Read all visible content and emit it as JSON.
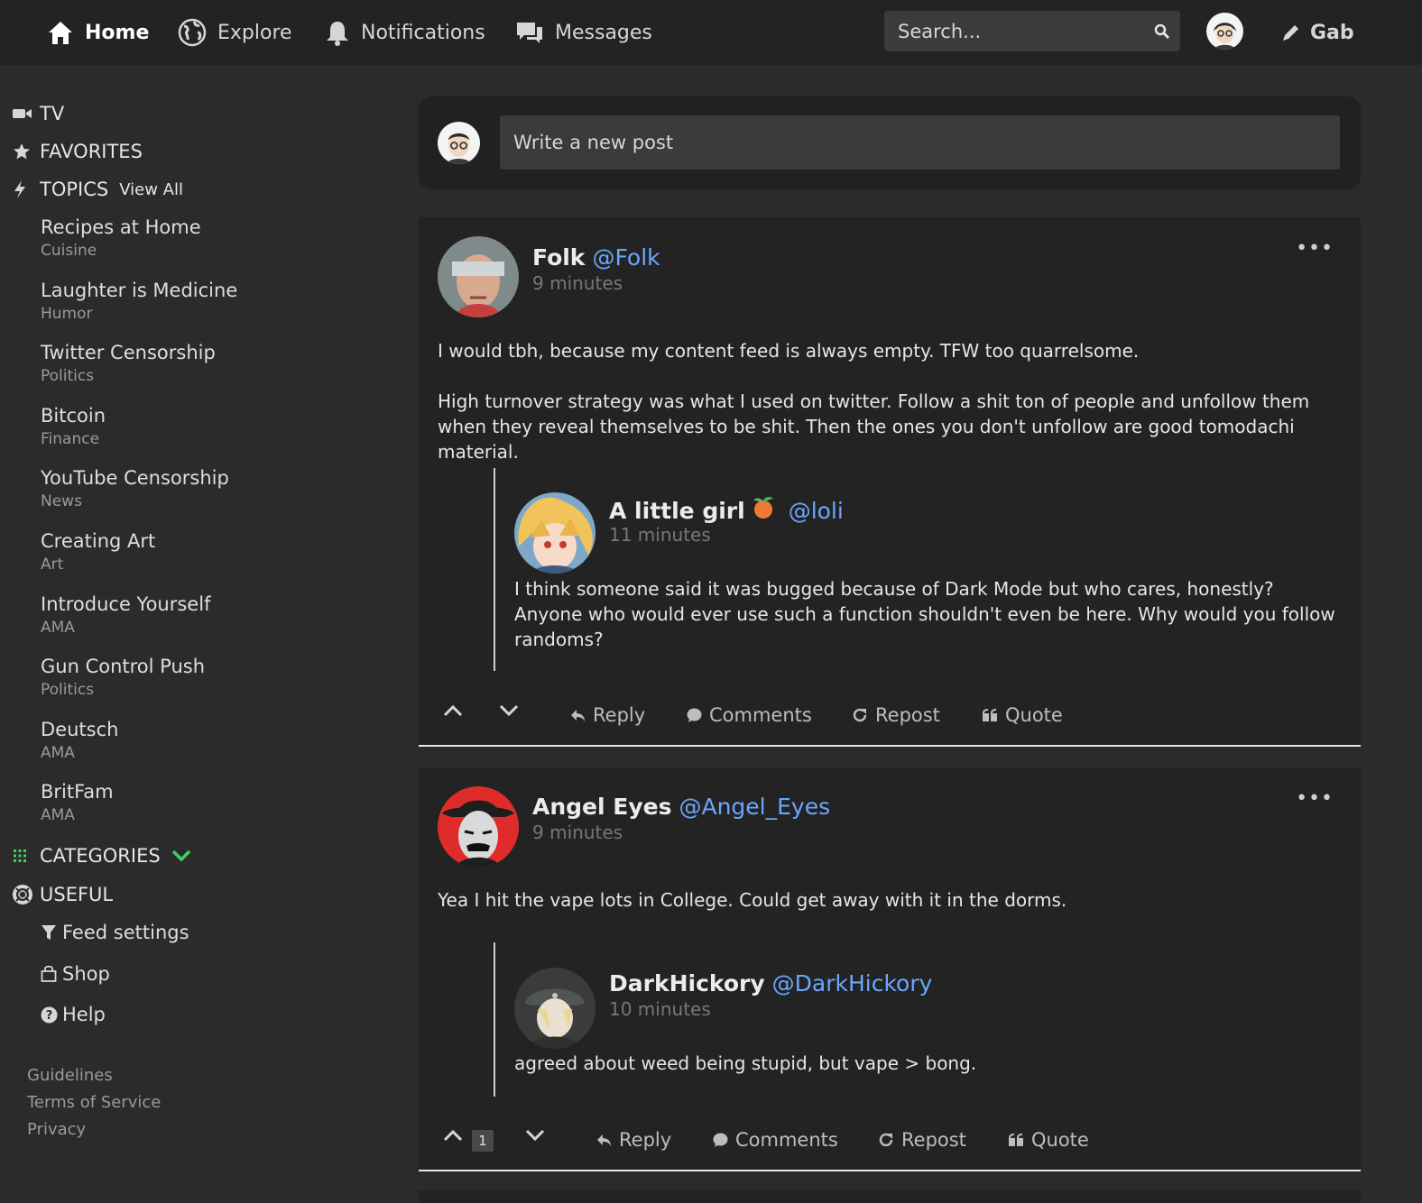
{
  "nav": {
    "home": "Home",
    "explore": "Explore",
    "notifications": "Notifications",
    "messages": "Messages",
    "search_placeholder": "Search...",
    "gab": "Gab"
  },
  "sidebar": {
    "tv": "TV",
    "favorites": "FAVORITES",
    "topics": "TOPICS",
    "view_all": "View All",
    "topic_items": [
      {
        "title": "Recipes at Home",
        "sub": "Cuisine"
      },
      {
        "title": "Laughter is Medicine",
        "sub": "Humor"
      },
      {
        "title": "Twitter Censorship",
        "sub": "Politics"
      },
      {
        "title": "Bitcoin",
        "sub": "Finance"
      },
      {
        "title": "YouTube Censorship",
        "sub": "News"
      },
      {
        "title": "Creating Art",
        "sub": "Art"
      },
      {
        "title": "Introduce Yourself",
        "sub": "AMA"
      },
      {
        "title": "Gun Control Push",
        "sub": "Politics"
      },
      {
        "title": "Deutsch",
        "sub": "AMA"
      },
      {
        "title": "BritFam",
        "sub": "AMA"
      }
    ],
    "categories": "CATEGORIES",
    "useful": "USEFUL",
    "useful_items": [
      "Feed settings",
      "Shop",
      "Help"
    ],
    "footer_links": [
      "Guidelines",
      "Terms of Service",
      "Privacy"
    ],
    "accent_green": "#3ecf6a"
  },
  "composer": {
    "placeholder": "Write a new post"
  },
  "posts": [
    {
      "name": "Folk",
      "handle": "@Folk",
      "time": "9 minutes",
      "body": [
        "I would tbh, because my content feed is always empty. TFW too quarrelsome.",
        "High turnover strategy was what I used on twitter. Follow a shit ton of people and unfollow them when they reveal themselves to be shit. Then the ones you don't unfollow are good tomodachi material."
      ],
      "quoted": {
        "name": "A little girl",
        "handle": "@loli",
        "time": "11 minutes",
        "body": "I think someone said it was bugged because of Dark Mode but who cares, honestly? Anyone who would ever use such a function shouldn't even be here. Why would you follow randoms?"
      },
      "vote_count": "",
      "actions": {
        "reply": "Reply",
        "comments": "Comments",
        "repost": "Repost",
        "quote": "Quote"
      }
    },
    {
      "name": "Angel Eyes",
      "handle": "@Angel_Eyes",
      "time": "9 minutes",
      "body": [
        "Yea I hit the vape lots in College.  Could get away with it in the dorms."
      ],
      "quoted": {
        "name": "DarkHickory",
        "handle": "@DarkHickory",
        "time": "10 minutes",
        "body": "agreed about weed being stupid, but vape > bong."
      },
      "vote_count": "1",
      "actions": {
        "reply": "Reply",
        "comments": "Comments",
        "repost": "Repost",
        "quote": "Quote"
      }
    }
  ],
  "colors": {
    "background": "#2b2b2b",
    "panel": "#232323",
    "handle_blue": "#6aa6ff"
  }
}
